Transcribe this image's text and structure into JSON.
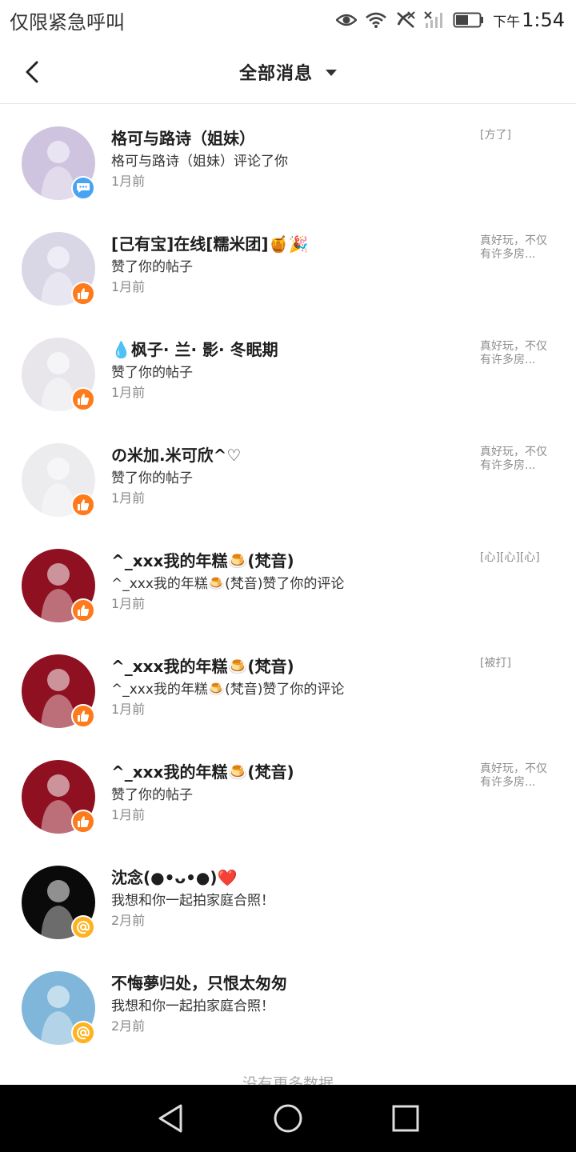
{
  "status_bar": {
    "carrier": "仅限紧急呼叫",
    "time_prefix": "下午",
    "time": "1:54",
    "icons": [
      "eye-icon",
      "wifi-icon",
      "no-call-icon",
      "no-signal-icon",
      "battery-icon"
    ]
  },
  "header": {
    "title": "全部消息",
    "back_icon": "chevron-left-icon",
    "dropdown_icon": "caret-down-icon"
  },
  "colors": {
    "like_badge": "#ff7a1a",
    "comment_badge": "#4aa3f0",
    "at_badge": "#ffb21f"
  },
  "messages": [
    {
      "name": "格可与路诗（姐妹）",
      "action": "格可与路诗（姐妹）评论了你",
      "time": "1月前",
      "ref": "[方了]",
      "badge": "comment",
      "avatar_bg": "#cfc4df"
    },
    {
      "name": "[己有宝]在线[糯米团]🍯🎉",
      "action": "赞了你的帖子",
      "time": "1月前",
      "ref": "真好玩，不仅有许多房...",
      "badge": "like",
      "avatar_bg": "#d9d6e6"
    },
    {
      "name": "💧枫子· 兰· 影· 冬眠期",
      "action": "赞了你的帖子",
      "time": "1月前",
      "ref": "真好玩，不仅有许多房...",
      "badge": "like",
      "avatar_bg": "#e8e6ea"
    },
    {
      "name": "の米加.米可欣^♡",
      "action": "赞了你的帖子",
      "time": "1月前",
      "ref": "真好玩，不仅有许多房...",
      "badge": "like",
      "avatar_bg": "#ececef"
    },
    {
      "name": "^_xxx我的年糕🍮(梵音)",
      "action": "^_xxx我的年糕🍮(梵音)赞了你的评论",
      "time": "1月前",
      "ref": "[心][心][心]",
      "badge": "like",
      "avatar_bg": "#8f1020"
    },
    {
      "name": "^_xxx我的年糕🍮(梵音)",
      "action": "^_xxx我的年糕🍮(梵音)赞了你的评论",
      "time": "1月前",
      "ref": "[被打]",
      "badge": "like",
      "avatar_bg": "#8f1020"
    },
    {
      "name": "^_xxx我的年糕🍮(梵音)",
      "action": "赞了你的帖子",
      "time": "1月前",
      "ref": "真好玩，不仅有许多房...",
      "badge": "like",
      "avatar_bg": "#8f1020"
    },
    {
      "name": "沈念(●•ᴗ•●)❤️",
      "action": "我想和你一起拍家庭合照！",
      "time": "2月前",
      "ref": "",
      "badge": "at",
      "avatar_bg": "#0a0a0a"
    },
    {
      "name": "不悔夢归处，只恨太匆匆",
      "action": "我想和你一起拍家庭合照！",
      "time": "2月前",
      "ref": "",
      "badge": "at",
      "avatar_bg": "#7fb6d9"
    }
  ],
  "footer_text": "没有更多数据",
  "nav": {
    "back": "triangle-back-icon",
    "home": "circle-home-icon",
    "recents": "square-recents-icon"
  }
}
